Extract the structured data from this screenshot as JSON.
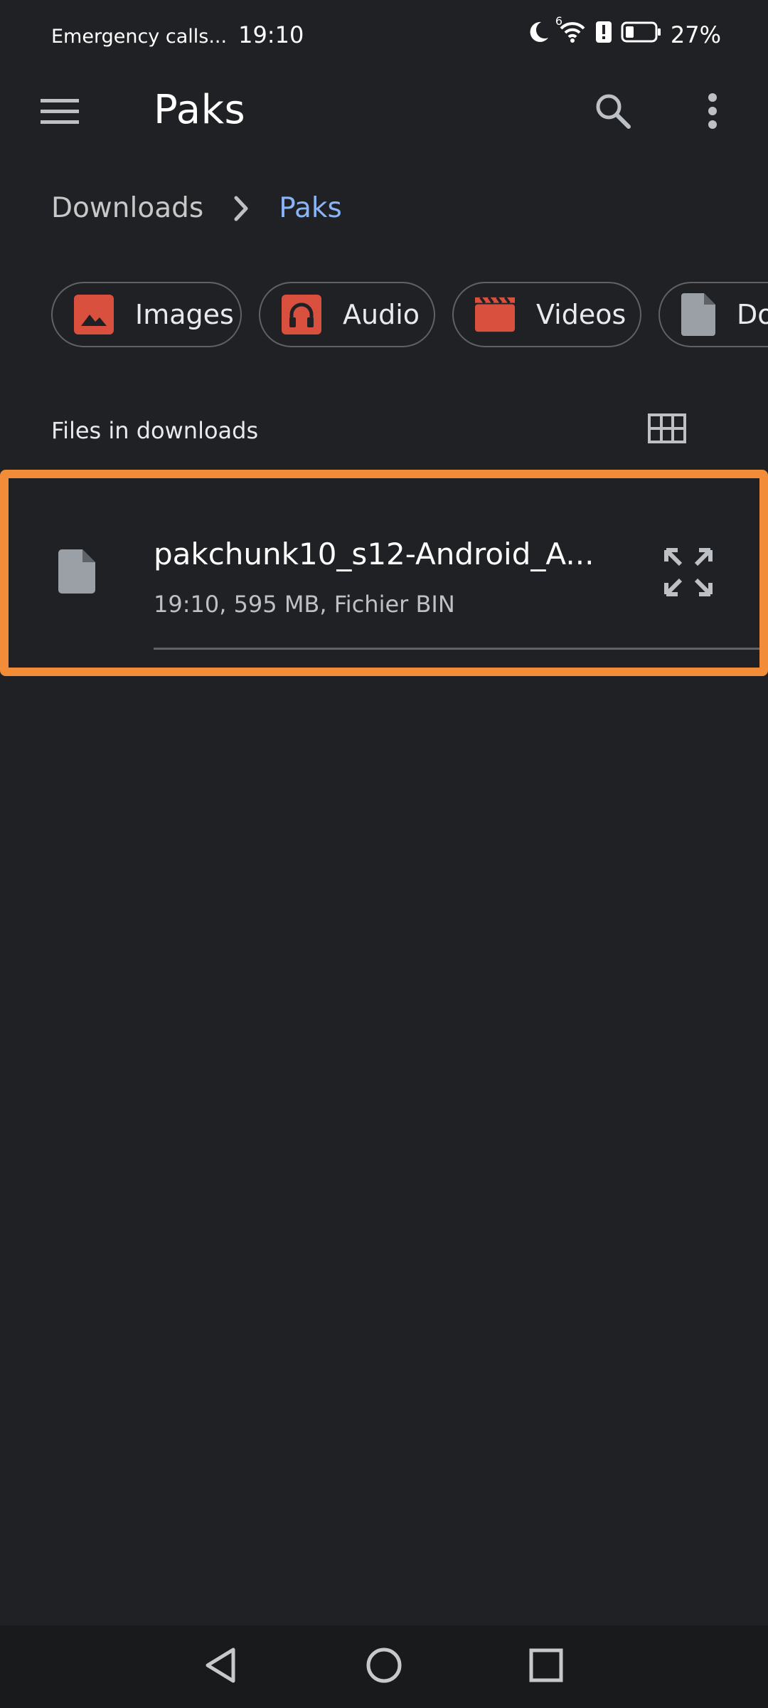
{
  "status_bar": {
    "carrier_text": "Emergency calls...",
    "time": "19:10",
    "battery_percent": "27%",
    "network_label": "6"
  },
  "app_bar": {
    "title": "Paks"
  },
  "breadcrumb": {
    "root": "Downloads",
    "current": "Paks"
  },
  "chips": [
    {
      "label": "Images",
      "icon": "image-icon"
    },
    {
      "label": "Audio",
      "icon": "headphones-icon"
    },
    {
      "label": "Videos",
      "icon": "movie-icon"
    },
    {
      "label": "Documents",
      "icon": "document-icon"
    }
  ],
  "section": {
    "title": "Files in downloads"
  },
  "files": [
    {
      "name": "pakchunk10_s12-Android_A...",
      "meta": "19:10, 595 MB, Fichier BIN",
      "icon": "file-icon"
    }
  ],
  "colors": {
    "background": "#202124",
    "accent_link": "#8ab4f8",
    "chip_icon_red": "#d9503f",
    "highlight_border": "#f28c38"
  }
}
